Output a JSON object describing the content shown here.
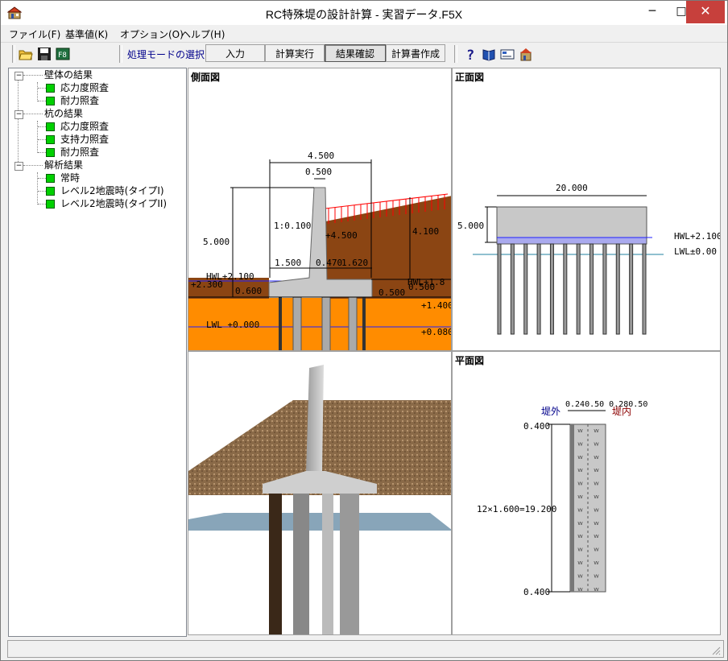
{
  "window": {
    "title": "RC特殊堤の設計計算 - 実習データ.F5X",
    "minimize": "─",
    "maximize": "□",
    "close": "✕"
  },
  "menu": [
    "ファイル(F)",
    "基準値(K)",
    "オプション(O)",
    "ヘルプ(H)"
  ],
  "toolbar": {
    "mode_label": "処理モードの選択",
    "modes": [
      "入力",
      "計算実行",
      "結果確認",
      "計算書作成"
    ],
    "active_mode": "結果確認",
    "icons": [
      "open-folder-icon",
      "save-icon",
      "export-icon",
      "help-icon",
      "book-icon",
      "card-icon",
      "building-icon"
    ]
  },
  "tree": {
    "groups": [
      {
        "label": "壁体の結果",
        "items": [
          "応力度照査",
          "耐力照査"
        ]
      },
      {
        "label": "杭の結果",
        "items": [
          "応力度照査",
          "支持力照査",
          "耐力照査"
        ]
      },
      {
        "label": "解析結果",
        "items": [
          "常時",
          "レベル2地震時(タイプI)",
          "レベル2地震時(タイプII)"
        ]
      }
    ],
    "collapse_symbol": "−"
  },
  "side_view": {
    "title": "側面図",
    "dims": {
      "total_width": "4.500",
      "top_width": "0.500",
      "height": "5.000",
      "slope": "1:0.100",
      "toe": "1.500",
      "mid": "0.470",
      "heel": "1.620",
      "fill_level": "+4.500",
      "right_height": "4.100",
      "hwl": "HWL+2.100",
      "left_ground": "+2.300",
      "footing": "0.600",
      "hwl_right": "HWL+1.8",
      "right_d1": "0.500",
      "right_d2": "0.500",
      "level_1400": "+1.400",
      "lwl": "LWL +0.000",
      "level_0080": "+0.080"
    }
  },
  "front_view": {
    "title": "正面図",
    "width": "20.000",
    "height": "5.000",
    "hwl": "HWL+2.100",
    "lwl": "LWL±0.00",
    "pile_count": 12
  },
  "plan_view": {
    "title": "平面図",
    "outer": "堤外",
    "inner": "堤内",
    "top_dims": "0.240.50 0.280.50",
    "end_top": "0.400",
    "middle": "12×1.600=19.200",
    "end_bottom": "0.400"
  },
  "view3d": {
    "title": ""
  },
  "colors": {
    "accent": "#00008b",
    "leaf": "#00d000",
    "soil": "#8b4513",
    "ground": "#ff8c00",
    "water": "#0000ff",
    "load": "#ff0000"
  }
}
